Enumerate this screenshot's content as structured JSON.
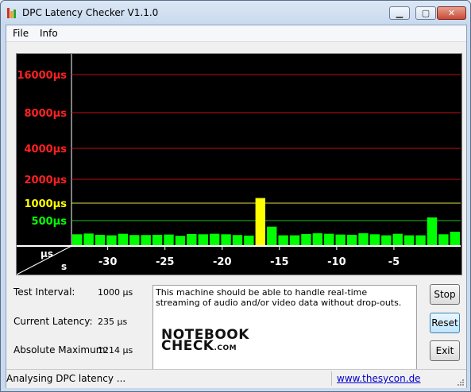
{
  "window": {
    "title": "DPC Latency Checker V1.1.0"
  },
  "menu": {
    "file": "File",
    "info": "Info"
  },
  "chart_data": {
    "type": "bar",
    "xlabel": "s",
    "ylabel": "µs",
    "x_ticks": [
      "-30",
      "-25",
      "-20",
      "-15",
      "-10",
      "-5"
    ],
    "y_ticks": [
      {
        "label": "16000µs",
        "color": "#ff2020"
      },
      {
        "label": "8000µs",
        "color": "#ff2020"
      },
      {
        "label": "4000µs",
        "color": "#ff2020"
      },
      {
        "label": "2000µs",
        "color": "#ff2020"
      },
      {
        "label": "1000µs",
        "color": "#ffff00"
      },
      {
        "label": "500µs",
        "color": "#00ff00"
      }
    ],
    "x": [
      -33,
      -32,
      -31,
      -30,
      -29,
      -28,
      -27,
      -26,
      -25,
      -24,
      -23,
      -22,
      -21,
      -20,
      -19,
      -18,
      -17,
      -16,
      -15,
      -14,
      -13,
      -12,
      -11,
      -10,
      -9,
      -8,
      -7,
      -6,
      -5,
      -4,
      -3,
      -2,
      -1
    ],
    "values": [
      230,
      245,
      220,
      210,
      240,
      215,
      215,
      220,
      225,
      200,
      235,
      230,
      240,
      230,
      215,
      205,
      1214,
      380,
      210,
      210,
      235,
      250,
      240,
      225,
      220,
      250,
      230,
      210,
      240,
      210,
      210,
      590,
      230,
      280
    ],
    "colors": {
      "ok": "#00ff00",
      "warn": "#ffff00",
      "grid_red": "#c01010",
      "grid_yellow": "#e0e040",
      "grid_green": "#20c020"
    }
  },
  "info": {
    "test_interval_label": "Test Interval:",
    "test_interval_value": "1000 µs",
    "current_latency_label": "Current Latency:",
    "current_latency_value": "235 µs",
    "absolute_max_label": "Absolute Maximum:",
    "absolute_max_value": "1214 µs"
  },
  "message": "This machine should be able to handle real-time streaming of audio and/or video data without drop-outs.",
  "logo": {
    "line1": "NOTEBOOK",
    "line2": "CHECK",
    "suffix": ".COM"
  },
  "buttons": {
    "stop": "Stop",
    "reset": "Reset",
    "exit": "Exit"
  },
  "status": {
    "text": "Analysing DPC latency ...",
    "link": "www.thesycon.de"
  }
}
